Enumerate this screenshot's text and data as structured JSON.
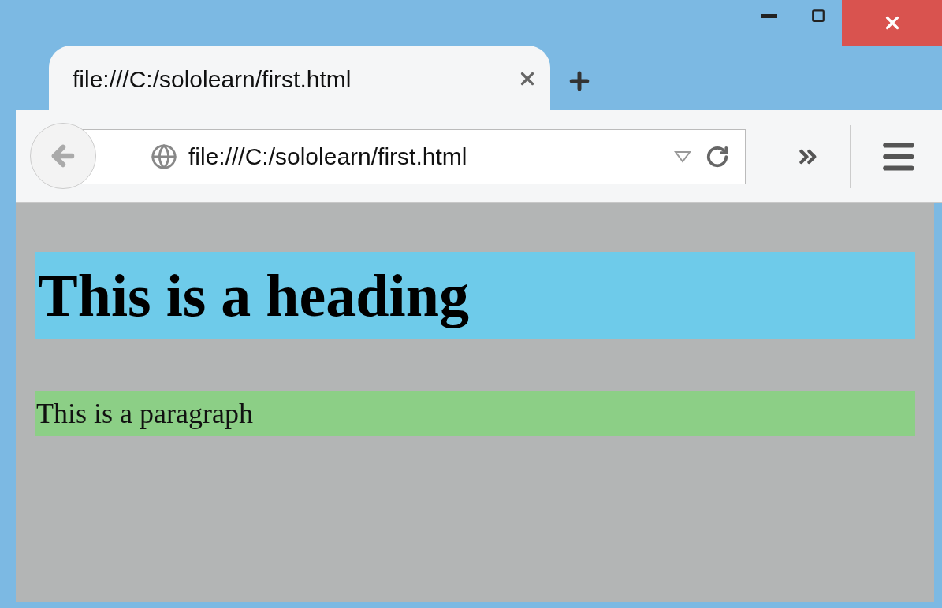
{
  "tab": {
    "title": "file:///C:/sololearn/first.html",
    "selected": true
  },
  "address_bar": {
    "value": "file:///C:/sololearn/first.html"
  },
  "page": {
    "heading": "This is a heading",
    "paragraph": "This is a paragraph"
  }
}
